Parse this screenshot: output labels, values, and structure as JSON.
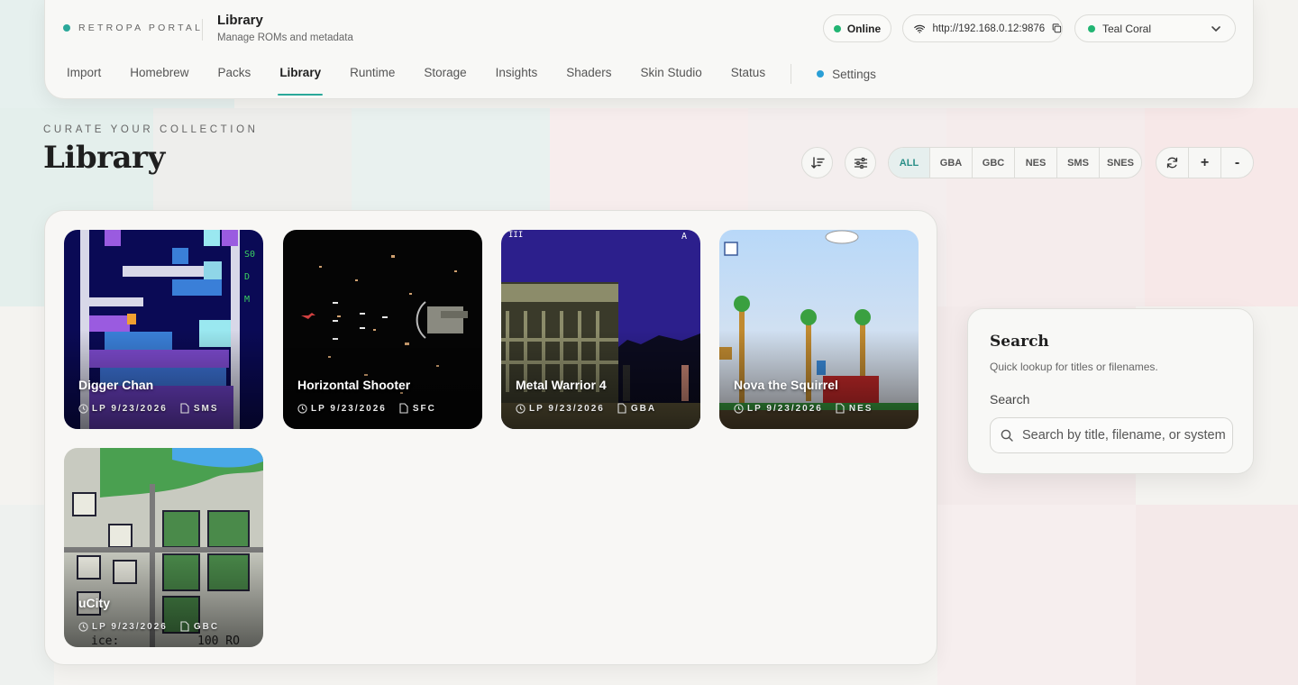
{
  "brand": {
    "name": "RETROPA PORTAL",
    "dot_color": "#2aa89a"
  },
  "header": {
    "title": "Library",
    "subtitle": "Manage ROMs and metadata"
  },
  "status": {
    "label": "Online",
    "color": "#22b573"
  },
  "connection": {
    "url": "http://192.168.0.12:9876",
    "wifi_icon": "wifi-icon",
    "copy_icon": "copy-icon"
  },
  "theme": {
    "selected": "Teal Coral",
    "dot_color": "#22b573"
  },
  "nav": {
    "tabs": [
      {
        "label": "Import"
      },
      {
        "label": "Homebrew"
      },
      {
        "label": "Packs"
      },
      {
        "label": "Library",
        "active": true
      },
      {
        "label": "Runtime"
      },
      {
        "label": "Storage"
      },
      {
        "label": "Insights"
      },
      {
        "label": "Shaders"
      },
      {
        "label": "Skin Studio"
      },
      {
        "label": "Status"
      }
    ],
    "settings": {
      "label": "Settings",
      "dot_color": "#2a9fd6"
    }
  },
  "page": {
    "eyebrow": "CURATE YOUR COLLECTION",
    "title": "Library"
  },
  "toolbar": {
    "sort_icon": "sort-icon",
    "filter_icon": "sliders-icon",
    "systems": [
      "ALL",
      "GBA",
      "GBC",
      "NES",
      "SMS",
      "SNES"
    ],
    "active_system": "ALL",
    "refresh_icon": "refresh-icon",
    "zoom_in": "+",
    "zoom_out": "-"
  },
  "games": [
    {
      "title": "Digger Chan",
      "last_played": "LP 9/23/2026",
      "system": "SMS"
    },
    {
      "title": "Horizontal Shooter",
      "last_played": "LP 9/23/2026",
      "system": "SFC"
    },
    {
      "title": "Metal Warrior 4",
      "last_played": "LP 9/23/2026",
      "system": "GBA"
    },
    {
      "title": "Nova the Squirrel",
      "last_played": "LP 9/23/2026",
      "system": "NES"
    },
    {
      "title": "uCity",
      "last_played": "LP 9/23/2026",
      "system": "GBC"
    }
  ],
  "search": {
    "title": "Search",
    "description": "Quick lookup for titles or filenames.",
    "label": "Search",
    "placeholder": "Search by title, filename, or system"
  },
  "colors": {
    "accent": "#2aa89a",
    "background": "#f4f3f0"
  }
}
